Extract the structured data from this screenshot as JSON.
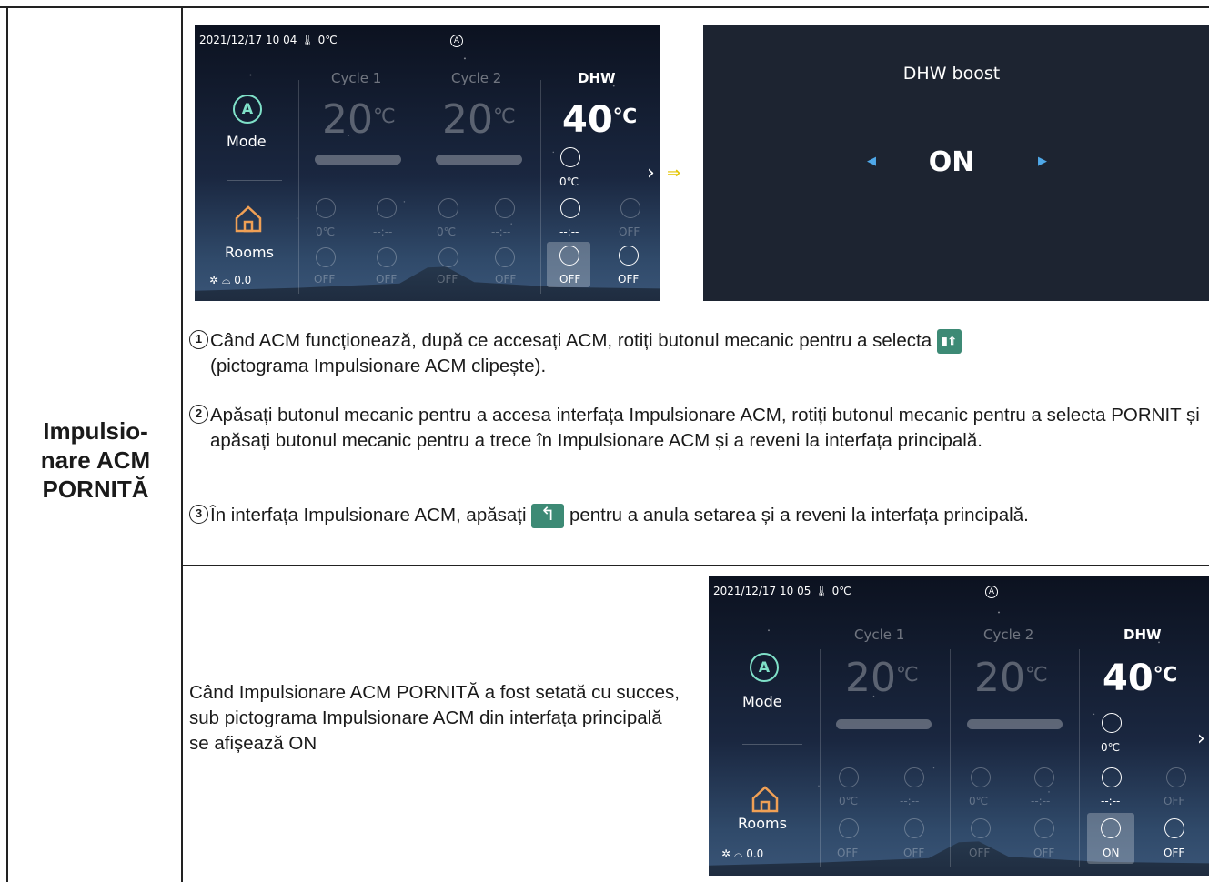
{
  "row_label": "Impulsio-\nnare ACM\nPORNITĂ",
  "screen_before": {
    "datetime": "2021/12/17 10 04",
    "outdoor_temp": "0℃",
    "auto_icon": "A",
    "mode_label": "Mode",
    "rooms_label": "Rooms",
    "pressure": "0.0",
    "cycle1": {
      "title": "Cycle 1",
      "temp": "20",
      "unit": "℃",
      "val1": "0℃",
      "val2": "--:--",
      "val3": "OFF",
      "val4": "OFF"
    },
    "cycle2": {
      "title": "Cycle 2",
      "temp": "20",
      "unit": "℃",
      "val1": "0℃",
      "val2": "--:--",
      "val3": "OFF",
      "val4": "OFF"
    },
    "dhw": {
      "title": "DHW",
      "temp": "40",
      "unit": "℃",
      "tank_temp": "0℃",
      "timer": "--:--",
      "schedule": "OFF",
      "boost": "OFF",
      "disinfect": "OFF"
    }
  },
  "boost_screen": {
    "title": "DHW boost",
    "value": "ON",
    "left_arrow": "◀",
    "right_arrow": "▶"
  },
  "transition_arrow": "⇒",
  "steps": [
    {
      "num": "1",
      "text_a": "Când ACM funcționează, după ce accesați ACM, rotiți butonul mecanic pentru a selecta",
      "icon": "boost-icon",
      "text_b": "(pictograma Impulsionare ACM clipește)."
    },
    {
      "num": "2",
      "text": "Apăsați butonul mecanic pentru a accesa interfața Impulsionare ACM, rotiți butonul mecanic pentru a selecta PORNIT și apăsați butonul mecanic pentru a trece în Impulsionare ACM și a reveni la interfața principală."
    },
    {
      "num": "3",
      "text_a": "În interfața Impulsionare ACM, apăsați",
      "icon": "back-icon",
      "text_b": "pentru a anula setarea și a reveni la interfața principală."
    }
  ],
  "note": "Când Impulsionare ACM PORNITĂ a fost setată cu succes, sub pictograma Impulsionare ACM din interfața principală se afișează ON",
  "screen_after": {
    "datetime": "2021/12/17 10 05",
    "outdoor_temp": "0℃",
    "auto_icon": "A",
    "mode_label": "Mode",
    "rooms_label": "Rooms",
    "pressure": "0.0",
    "cycle1": {
      "title": "Cycle 1",
      "temp": "20",
      "unit": "℃",
      "val1": "0℃",
      "val2": "--:--",
      "val3": "OFF",
      "val4": "OFF"
    },
    "cycle2": {
      "title": "Cycle 2",
      "temp": "20",
      "unit": "℃",
      "val1": "0℃",
      "val2": "--:--",
      "val3": "OFF",
      "val4": "OFF"
    },
    "dhw": {
      "title": "DHW",
      "temp": "40",
      "unit": "℃",
      "tank_temp": "0℃",
      "timer": "--:--",
      "schedule": "OFF",
      "boost": "ON",
      "disinfect": "OFF"
    }
  }
}
